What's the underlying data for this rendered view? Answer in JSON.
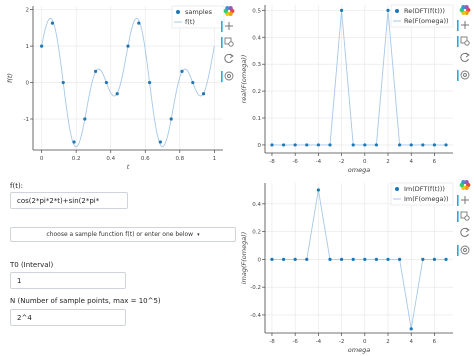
{
  "colors": {
    "sample_marker": "#1f77b4",
    "line": "#a6c8e8",
    "toolbar_accent": "#26aae1",
    "grid": "#e6e6e6"
  },
  "form": {
    "function_label": "f(t):",
    "function_value": "cos(2*pi*2*t)+sin(2*pi*",
    "select_text": "choose a sample function f(t) or enter one below",
    "t0_label": "T0 (Interval)",
    "t0_value": "1",
    "n_label": "N (Number of sample points, max = 10^5)",
    "n_value": "2^4"
  },
  "toolbar_icons": [
    "bokeh-logo-icon",
    "pan-icon",
    "box-zoom-icon",
    "reset-icon",
    "wheel-zoom-icon"
  ],
  "chart_data": [
    {
      "type": "line",
      "title": "",
      "xlabel": "t",
      "ylabel": "f(t)",
      "xlim": [
        -0.05,
        1.05
      ],
      "ylim": [
        -1.85,
        2.1
      ],
      "xticks": [
        0,
        0.2,
        0.4,
        0.6,
        0.8,
        1
      ],
      "xtick_labels": [
        "0",
        "0.2",
        "0.4",
        "0.6",
        "0.8",
        "1"
      ],
      "yticks": [
        -1,
        0,
        1,
        2
      ],
      "ytick_labels": [
        "-1",
        "0",
        "1",
        "2"
      ],
      "legend": [
        {
          "name": "samples",
          "marker": "dot"
        },
        {
          "name": "f(t)",
          "marker": "line"
        }
      ],
      "legend_position": "top-right",
      "grid": true,
      "series": [
        {
          "name": "samples",
          "kind": "scatter",
          "x": [
            0,
            0.0625,
            0.125,
            0.1875,
            0.25,
            0.3125,
            0.375,
            0.4375,
            0.5,
            0.5625,
            0.625,
            0.6875,
            0.75,
            0.8125,
            0.875,
            0.9375
          ],
          "values": [
            1,
            1.631,
            0,
            -1.631,
            -1,
            0.307,
            0,
            -0.307,
            1,
            1.631,
            0,
            -1.631,
            -1,
            0.307,
            0,
            -0.307
          ]
        },
        {
          "name": "f(t)",
          "kind": "line",
          "function": "cos(2*pi*2*t)+sin(2*pi*4*t)",
          "range": [
            0,
            1
          ]
        }
      ]
    },
    {
      "type": "line",
      "title": "",
      "xlabel": "omega",
      "ylabel": "real(F(omega))",
      "xlim": [
        -8.6,
        7.6
      ],
      "ylim": [
        -0.03,
        0.52
      ],
      "xticks": [
        -8,
        -6,
        -4,
        -2,
        0,
        2,
        4,
        6
      ],
      "xtick_labels": [
        "-8",
        "-6",
        "-4",
        "-2",
        "0",
        "2",
        "4",
        "6"
      ],
      "yticks": [
        0,
        0.1,
        0.2,
        0.3,
        0.4,
        0.5
      ],
      "ytick_labels": [
        "0",
        "0.1",
        "0.2",
        "0.3",
        "0.4",
        "0.5"
      ],
      "legend": [
        {
          "name": "Re(DFT(f(t)))",
          "marker": "dot"
        },
        {
          "name": "Re(F(omega))",
          "marker": "line"
        }
      ],
      "legend_position": "top-right",
      "grid": true,
      "series": [
        {
          "name": "Re(DFT(f(t)))",
          "kind": "scatter",
          "x": [
            -8,
            -7,
            -6,
            -5,
            -4,
            -3,
            -2,
            -1,
            0,
            1,
            2,
            3,
            4,
            5,
            6,
            7
          ],
          "values": [
            0,
            0,
            0,
            0,
            0,
            0,
            0.5,
            0,
            0,
            0,
            0.5,
            0,
            0,
            0,
            0,
            0
          ]
        },
        {
          "name": "Re(F(omega))",
          "kind": "line",
          "x": [
            -8,
            -7,
            -6,
            -5,
            -4,
            -3,
            -2,
            -1,
            0,
            1,
            2,
            3,
            4,
            5,
            6,
            7
          ],
          "values": [
            0,
            0,
            0,
            0,
            0,
            0,
            0.5,
            0,
            0,
            0,
            0.5,
            0,
            0,
            0,
            0,
            0
          ]
        }
      ]
    },
    {
      "type": "line",
      "title": "",
      "xlabel": "omega",
      "ylabel": "imag(F(omega))",
      "xlim": [
        -8.6,
        7.6
      ],
      "ylim": [
        -0.53,
        0.55
      ],
      "xticks": [
        -8,
        -6,
        -4,
        -2,
        0,
        2,
        4,
        6
      ],
      "xtick_labels": [
        "-8",
        "-6",
        "-4",
        "-2",
        "0",
        "2",
        "4",
        "6"
      ],
      "yticks": [
        -0.4,
        -0.2,
        0,
        0.2,
        0.4
      ],
      "ytick_labels": [
        "-0.4",
        "-0.2",
        "0",
        "0.2",
        "0.4"
      ],
      "legend": [
        {
          "name": "Im(DFT(f(t)))",
          "marker": "dot"
        },
        {
          "name": "Im(F(omega))",
          "marker": "line"
        }
      ],
      "legend_position": "top-right",
      "grid": true,
      "series": [
        {
          "name": "Im(DFT(f(t)))",
          "kind": "scatter",
          "x": [
            -8,
            -7,
            -6,
            -5,
            -4,
            -3,
            -2,
            -1,
            0,
            1,
            2,
            3,
            4,
            5,
            6,
            7
          ],
          "values": [
            0,
            0,
            0,
            0,
            0.5,
            0,
            0,
            0,
            0,
            0,
            0,
            0,
            -0.5,
            0,
            0,
            0
          ]
        },
        {
          "name": "Im(F(omega))",
          "kind": "line",
          "x": [
            -8,
            -7,
            -6,
            -5,
            -4,
            -3,
            -2,
            -1,
            0,
            1,
            2,
            3,
            4,
            5,
            6,
            7
          ],
          "values": [
            0,
            0,
            0,
            0,
            0.5,
            0,
            0,
            0,
            0,
            0,
            0,
            0,
            -0.5,
            0,
            0,
            0
          ]
        }
      ]
    }
  ]
}
